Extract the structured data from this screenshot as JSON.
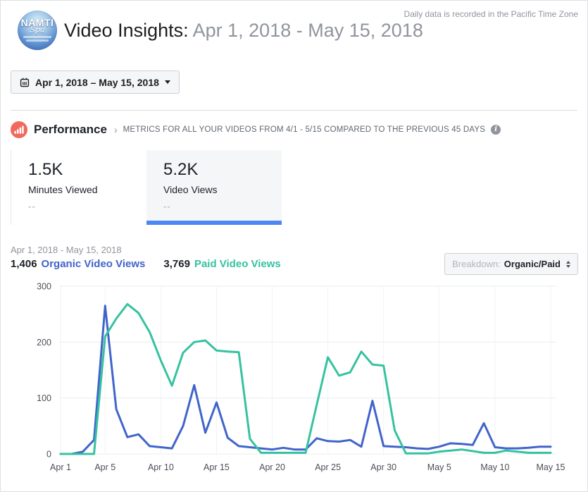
{
  "page": {
    "logo_text": "NAMTI",
    "logo_subtext": "Spa",
    "title": "Video Insights:",
    "title_range": "Apr 1, 2018 - May 15, 2018",
    "timezone_note": "Daily data is recorded in the Pacific Time Zone"
  },
  "date_picker": {
    "label": "Apr 1, 2018 – May 15, 2018"
  },
  "performance": {
    "title": "Performance",
    "chevron": "›",
    "subtitle": "METRICS FOR ALL YOUR VIDEOS FROM 4/1 - 5/15 COMPARED TO THE PREVIOUS 45 DAYS"
  },
  "metric_cards": [
    {
      "value": "1.5K",
      "label": "Minutes Viewed",
      "delta": "--"
    },
    {
      "value": "5.2K",
      "label": "Video Views",
      "delta": "--"
    }
  ],
  "chart_header": {
    "range": "Apr 1, 2018 - May 15, 2018",
    "organic_total": "1,406",
    "organic_label": "Organic Video Views",
    "paid_total": "3,769",
    "paid_label": "Paid Video Views",
    "breakdown_label": "Breakdown:",
    "breakdown_value": "Organic/Paid"
  },
  "colors": {
    "organic": "#4164cb",
    "paid": "#35c2a0",
    "selected_tab_bar": "#4c87f5",
    "performance_icon": "#f2685c",
    "grid_horizontal": "#e9ebee",
    "grid_vertical": "#f0f2f5"
  },
  "chart_data": {
    "type": "line",
    "title": "Daily video views, Organic vs Paid, Apr 1 - May 15, 2018",
    "ylim": [
      0,
      300
    ],
    "y_ticks": [
      0,
      100,
      200,
      300
    ],
    "grid": true,
    "legend_position": "top-left",
    "x_tick_labels": [
      "Apr 1",
      "Apr 5",
      "Apr 10",
      "Apr 15",
      "Apr 20",
      "Apr 25",
      "Apr 30",
      "May 5",
      "May 10",
      "May 15"
    ],
    "x_tick_days": [
      0,
      4,
      9,
      14,
      19,
      24,
      29,
      34,
      39,
      44
    ],
    "categories": [
      "Apr 1",
      "Apr 2",
      "Apr 3",
      "Apr 4",
      "Apr 5",
      "Apr 6",
      "Apr 7",
      "Apr 8",
      "Apr 9",
      "Apr 10",
      "Apr 11",
      "Apr 12",
      "Apr 13",
      "Apr 14",
      "Apr 15",
      "Apr 16",
      "Apr 17",
      "Apr 18",
      "Apr 19",
      "Apr 20",
      "Apr 21",
      "Apr 22",
      "Apr 23",
      "Apr 24",
      "Apr 25",
      "Apr 26",
      "Apr 27",
      "Apr 28",
      "Apr 29",
      "Apr 30",
      "May 1",
      "May 2",
      "May 3",
      "May 4",
      "May 5",
      "May 6",
      "May 7",
      "May 8",
      "May 9",
      "May 10",
      "May 11",
      "May 12",
      "May 13",
      "May 14",
      "May 15"
    ],
    "series": [
      {
        "name": "Organic Video Views",
        "total": 1406,
        "color": "#4164cb",
        "values": [
          0,
          0,
          4,
          25,
          265,
          80,
          30,
          35,
          14,
          12,
          10,
          50,
          123,
          38,
          92,
          29,
          14,
          12,
          10,
          8,
          11,
          8,
          8,
          28,
          23,
          22,
          25,
          13,
          95,
          14,
          13,
          12,
          10,
          9,
          13,
          19,
          18,
          16,
          55,
          12,
          10,
          10,
          11,
          13,
          13
        ]
      },
      {
        "name": "Paid Video Views",
        "total": 3769,
        "color": "#35c2a0",
        "values": [
          0,
          0,
          0,
          0,
          210,
          242,
          268,
          252,
          218,
          167,
          122,
          181,
          200,
          203,
          185,
          183,
          182,
          27,
          2,
          2,
          2,
          2,
          2,
          88,
          173,
          140,
          146,
          183,
          160,
          158,
          42,
          1,
          1,
          1,
          4,
          6,
          8,
          5,
          2,
          2,
          6,
          4,
          2,
          2,
          2
        ]
      }
    ]
  }
}
